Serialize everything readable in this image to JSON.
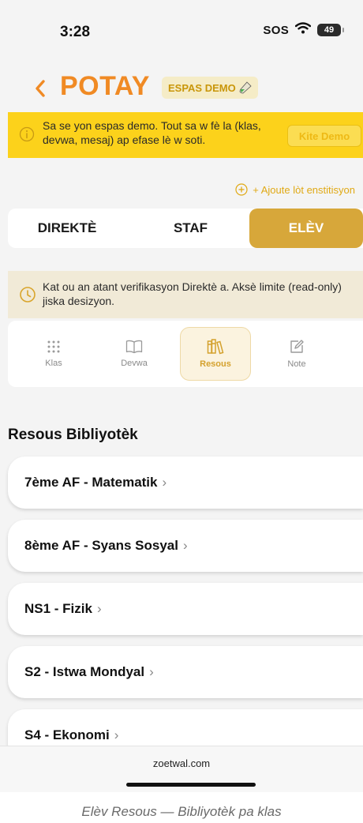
{
  "status_bar": {
    "time": "3:28",
    "sos": "SOS",
    "battery": "49"
  },
  "header": {
    "title": "POTAY",
    "badge": "ESPAS DEMO"
  },
  "demo_banner": {
    "text": "Sa se yon espas demo. Tout sa w fè la (klas, devwa, mesaj) ap efase lè w soti.",
    "exit_button": "Kite Demo"
  },
  "add_institution": "+ Ajoute lòt enstitisyon",
  "role_tabs": [
    {
      "label": "DIREKTÈ"
    },
    {
      "label": "STAF"
    },
    {
      "label": "ELÈV",
      "active": true
    }
  ],
  "verify_notice": "Kat ou an atant verifikasyon Direktè a. Aksè limite (read-only) jiska desizyon.",
  "feature_tabs": [
    {
      "label": "Klas",
      "icon": "grid-icon"
    },
    {
      "label": "Devwa",
      "icon": "book-icon"
    },
    {
      "label": "Resous",
      "icon": "library-icon",
      "active": true
    },
    {
      "label": "Note",
      "icon": "edit-note-icon"
    }
  ],
  "section_title": "Resous Bibliyotèk",
  "library_items": [
    {
      "label": "7ème AF - Matematik"
    },
    {
      "label": "8ème AF - Syans Sosyal"
    },
    {
      "label": "NS1 - Fizik"
    },
    {
      "label": "S2 - Istwa Mondyal"
    },
    {
      "label": "S4 - Ekonomi"
    }
  ],
  "chevron": "›",
  "url": "zoetwal.com",
  "caption": "Elèv Resous — Bibliyotèk pa klas",
  "colors": {
    "brand": "#f08a24",
    "accent": "#d7a73a",
    "banner": "#fcd21b"
  }
}
